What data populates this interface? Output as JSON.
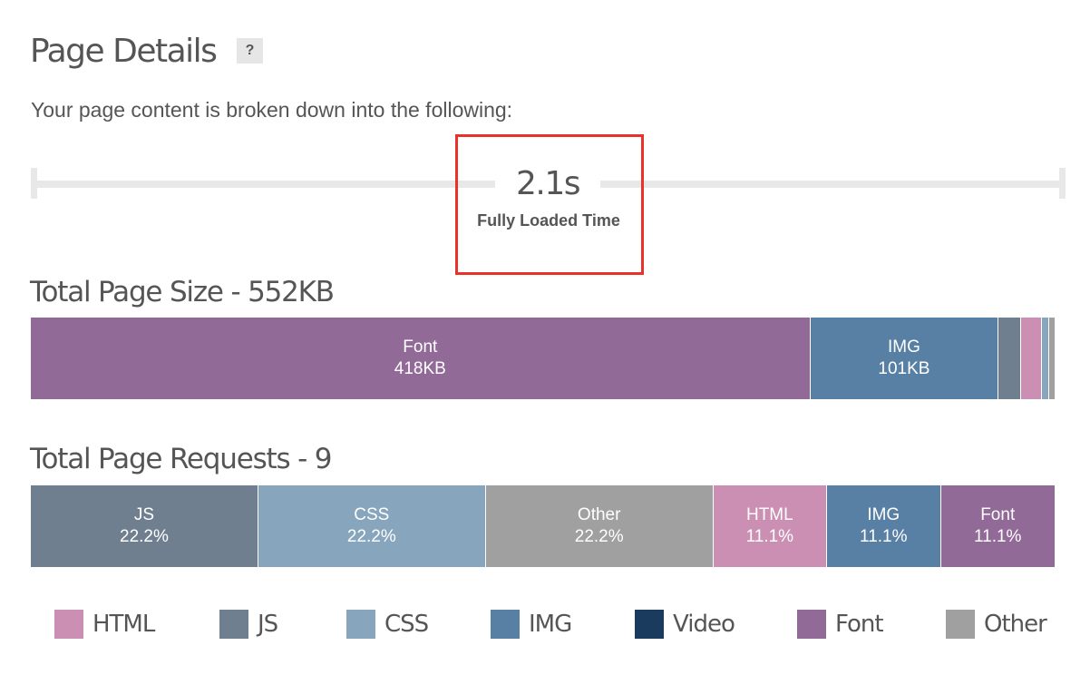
{
  "header": {
    "title": "Page Details",
    "help_label": "?",
    "intro": "Your page content is broken down into the following:"
  },
  "timeline": {
    "value": "2.1s",
    "label": "Fully Loaded Time",
    "highlight_color": "#e8322a"
  },
  "size_section": {
    "title": "Total Page Size - 552KB",
    "segments": [
      {
        "type": "Font",
        "value_kb": 418,
        "label": "418KB",
        "color": "#916a98",
        "show_label": true
      },
      {
        "type": "IMG",
        "value_kb": 101,
        "label": "101KB",
        "color": "#5880a5",
        "show_label": true
      },
      {
        "type": "JS",
        "value_kb": 12,
        "label": "",
        "color": "#6f7f8f",
        "show_label": false
      },
      {
        "type": "HTML",
        "value_kb": 11,
        "label": "",
        "color": "#cc8fb4",
        "show_label": false
      },
      {
        "type": "CSS",
        "value_kb": 4,
        "label": "",
        "color": "#87a6be",
        "show_label": false
      },
      {
        "type": "Other",
        "value_kb": 3,
        "label": "",
        "color": "#a0a0a0",
        "show_label": false
      }
    ]
  },
  "requests_section": {
    "title": "Total Page Requests - 9",
    "segments": [
      {
        "type": "JS",
        "percent": 22.2,
        "label": "22.2%",
        "color": "#6f7f8f"
      },
      {
        "type": "CSS",
        "percent": 22.2,
        "label": "22.2%",
        "color": "#87a6be"
      },
      {
        "type": "Other",
        "percent": 22.2,
        "label": "22.2%",
        "color": "#a0a0a0"
      },
      {
        "type": "HTML",
        "percent": 11.1,
        "label": "11.1%",
        "color": "#cc8fb4"
      },
      {
        "type": "IMG",
        "percent": 11.1,
        "label": "11.1%",
        "color": "#5880a5"
      },
      {
        "type": "Font",
        "percent": 11.1,
        "label": "11.1%",
        "color": "#916a98"
      }
    ]
  },
  "legend": [
    {
      "label": "HTML",
      "color": "#cc8fb4"
    },
    {
      "label": "JS",
      "color": "#6f7f8f"
    },
    {
      "label": "CSS",
      "color": "#87a6be"
    },
    {
      "label": "IMG",
      "color": "#5880a5"
    },
    {
      "label": "Video",
      "color": "#1b3b5e"
    },
    {
      "label": "Font",
      "color": "#916a98"
    },
    {
      "label": "Other",
      "color": "#a0a0a0"
    }
  ]
}
